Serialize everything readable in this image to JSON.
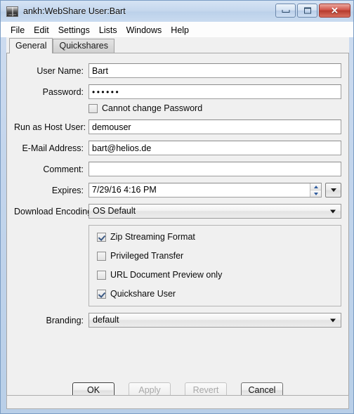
{
  "window": {
    "title": "ankh:WebShare User:Bart",
    "icon_name": "helios-logo-icon",
    "icon_text": "HELIOS",
    "controls": {
      "minimize": "Minimize",
      "maximize": "Maximize",
      "close": "✕"
    },
    "colors": {
      "titlebar": "#c3d5ec",
      "border": "#7b9dc4",
      "panel": "#f0f0f0",
      "close_button": "#c9503f",
      "accent": "#3c5a85"
    }
  },
  "menubar": {
    "items": [
      {
        "label": "File"
      },
      {
        "label": "Edit"
      },
      {
        "label": "Settings"
      },
      {
        "label": "Lists"
      },
      {
        "label": "Windows"
      },
      {
        "label": "Help"
      }
    ]
  },
  "tabs": [
    {
      "label": "General",
      "selected": true
    },
    {
      "label": "Quickshares",
      "selected": false
    }
  ],
  "form": {
    "user_name": {
      "label": "User Name:",
      "value": "Bart"
    },
    "password": {
      "label": "Password:",
      "value": "••••••"
    },
    "cannot_change_password": {
      "label": "Cannot change Password",
      "checked": false
    },
    "run_as_host_user": {
      "label": "Run as Host User:",
      "value": "demouser"
    },
    "email_address": {
      "label": "E-Mail Address:",
      "value": "bart@helios.de"
    },
    "comment": {
      "label": "Comment:",
      "value": ""
    },
    "expires": {
      "label": "Expires:",
      "value": "7/29/16 4:16 PM"
    },
    "download_encoding": {
      "label": "Download Encoding:",
      "value": "OS Default"
    },
    "options": [
      {
        "label": "Zip Streaming Format",
        "checked": true
      },
      {
        "label": "Privileged Transfer",
        "checked": false
      },
      {
        "label": "URL Document Preview only",
        "checked": false
      },
      {
        "label": "Quickshare User",
        "checked": true
      }
    ],
    "branding": {
      "label": "Branding:",
      "value": "default"
    }
  },
  "buttons": [
    {
      "label": "OK",
      "state": "default"
    },
    {
      "label": "Apply",
      "state": "disabled"
    },
    {
      "label": "Revert",
      "state": "disabled"
    },
    {
      "label": "Cancel",
      "state": "enabled"
    }
  ]
}
